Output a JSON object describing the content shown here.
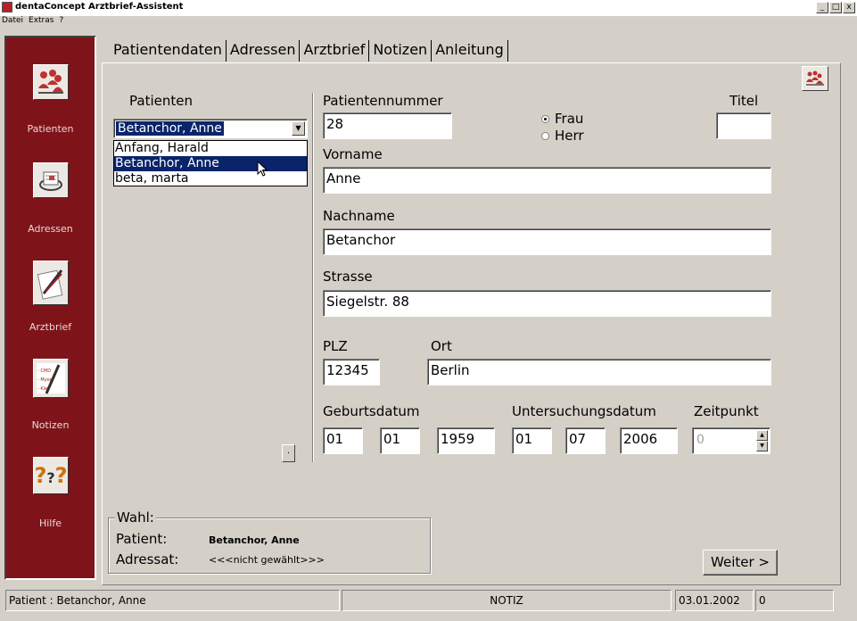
{
  "window": {
    "title": "dentaConcept Arztbrief-Assistent",
    "controls": [
      "_",
      "□",
      "x"
    ]
  },
  "menu": [
    "Datei",
    "Extras",
    "?"
  ],
  "sidebar": {
    "items": [
      {
        "label": "Patienten",
        "icon": "patients-icon"
      },
      {
        "label": "Adressen",
        "icon": "rolodex-icon"
      },
      {
        "label": "Arztbrief",
        "icon": "letter-pen-icon"
      },
      {
        "label": "Notizen",
        "icon": "notes-icon"
      },
      {
        "label": "Hilfe",
        "icon": "help-icon"
      }
    ],
    "accent": "#7e1419"
  },
  "tabs": [
    "Patientendaten",
    "Adressen",
    "Arztbrief",
    "Notizen",
    "Anleitung"
  ],
  "patienten": {
    "label": "Patienten",
    "selected": "Betanchor, Anne",
    "options": [
      "Anfang, Harald",
      "Betanchor, Anne",
      "beta, marta"
    ],
    "small_button": "."
  },
  "form": {
    "patientennummer_label": "Patientennummer",
    "patientennummer": "28",
    "anrede_frau": "Frau",
    "anrede_herr": "Herr",
    "titel_label": "Titel",
    "titel": "",
    "vorname_label": "Vorname",
    "vorname": "Anne",
    "nachname_label": "Nachname",
    "nachname": "Betanchor",
    "strasse_label": "Strasse",
    "strasse": "Siegelstr. 88",
    "plz_label": "PLZ",
    "plz": "12345",
    "ort_label": "Ort",
    "ort": "Berlin",
    "geburtsdatum_label": "Geburtsdatum",
    "geb_tag": "01",
    "geb_monat": "01",
    "geb_jahr": "1959",
    "untersuchungsdatum_label": "Untersuchungsdatum",
    "unt_tag": "01",
    "unt_monat": "07",
    "unt_jahr": "2006",
    "zeitpunkt_label": "Zeitpunkt",
    "zeitpunkt": "0"
  },
  "wahl": {
    "title": "Wahl:",
    "patient_label": "Patient:",
    "patient_value": "Betanchor, Anne",
    "adressat_label": "Adressat:",
    "adressat_value": "<<<nicht gewählt>>>"
  },
  "weiter_label": "Weiter >",
  "status": {
    "patient": "Patient : Betanchor, Anne",
    "notiz": "NOTIZ",
    "date": "03.01.2002",
    "count": "0"
  }
}
